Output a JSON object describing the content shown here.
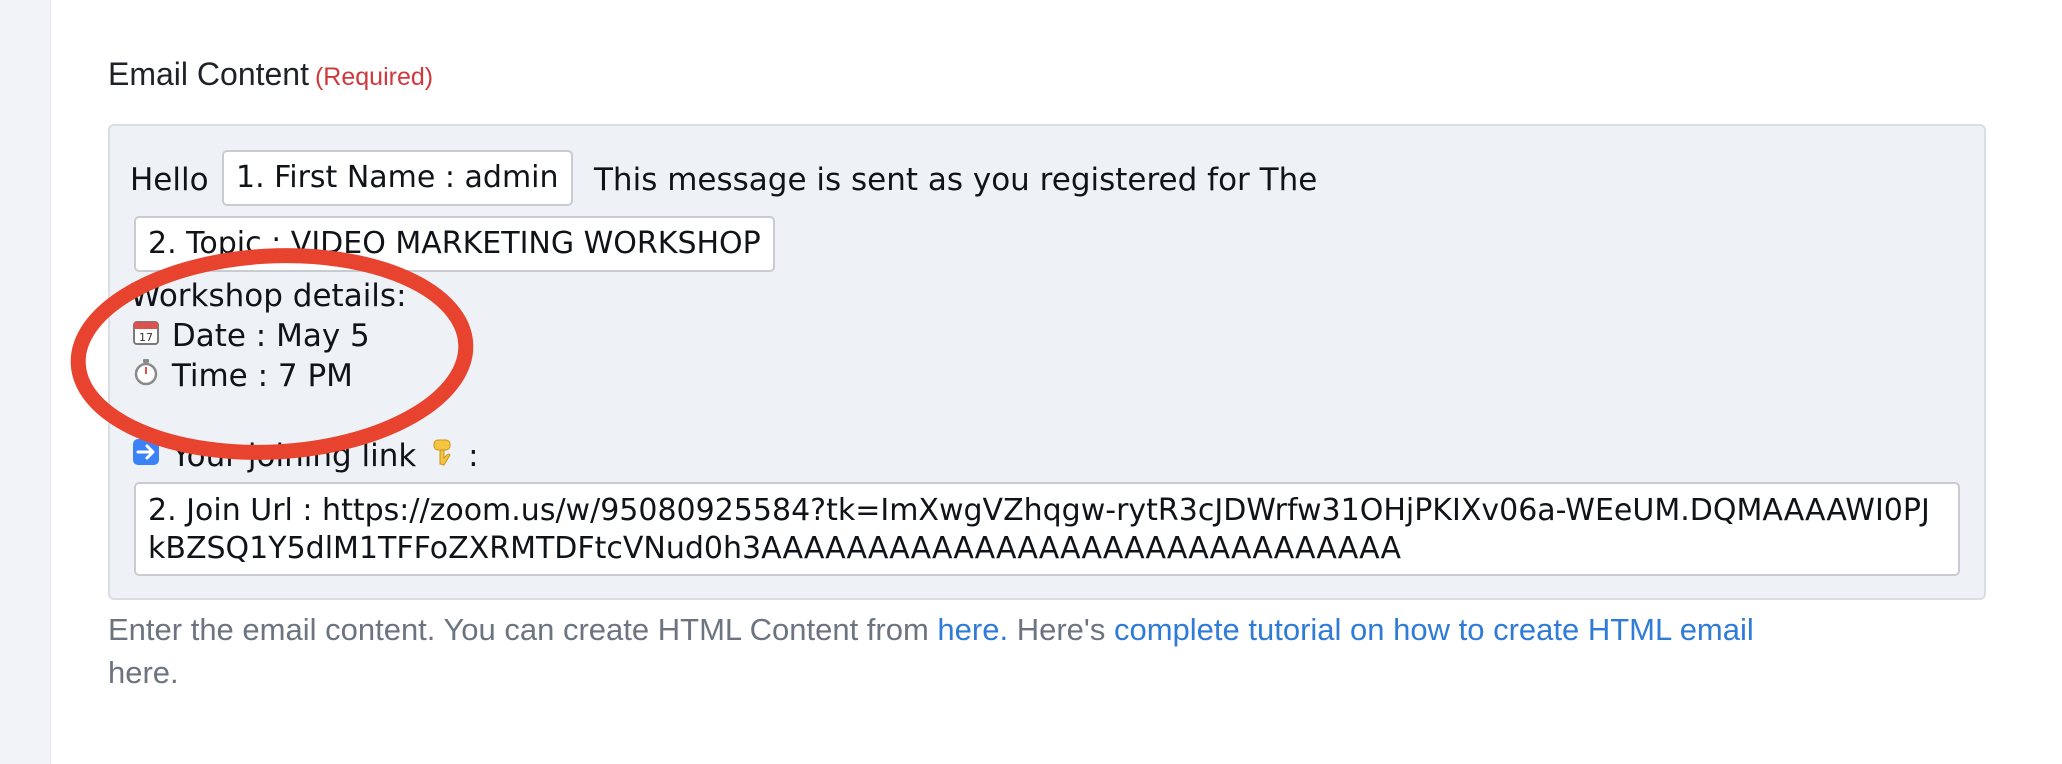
{
  "section": {
    "label": "Email Content",
    "required_label": "(Required)"
  },
  "editor": {
    "greeting": "Hello",
    "first_name_tag": "1. First Name : admin",
    "sent_message": "This message is sent as you registered for The",
    "topic_tag": "2. Topic : VIDEO MARKETING WORKSHOP",
    "workshop_details": "Workshop details:",
    "date_icon": "calendar-icon",
    "date_line": "Date : May 5",
    "time_icon": "stopwatch-icon",
    "time_line": "Time : 7 PM",
    "arrow_icon": "right-arrow-icon",
    "joining_link_label": "Your joining link",
    "pointing_icon": "pointing-down-icon",
    "joining_colon": ":",
    "join_url_tag": "2. Join Url : https://zoom.us/w/95080925584?tk=ImXwgVZhqgw-rytR3cJDWrfw31OHjPKIXv06a-WEeUM.DQMAAAAWI0PJkBZSQ1Y5dlM1TFFoZXRMTDFtcVNud0h3AAAAAAAAAAAAAAAAAAAAAAAAAAAAAA"
  },
  "help": {
    "text_before": "Enter the email content. You can create HTML Content from",
    "link_here": "here.",
    "text_middle": "Here's",
    "link_tutorial": "complete tutorial on how to create HTML email",
    "text_after": "here."
  },
  "colors": {
    "required": "#d0393c",
    "link": "#2f7bd8",
    "annotation_circle": "#e8432e"
  }
}
